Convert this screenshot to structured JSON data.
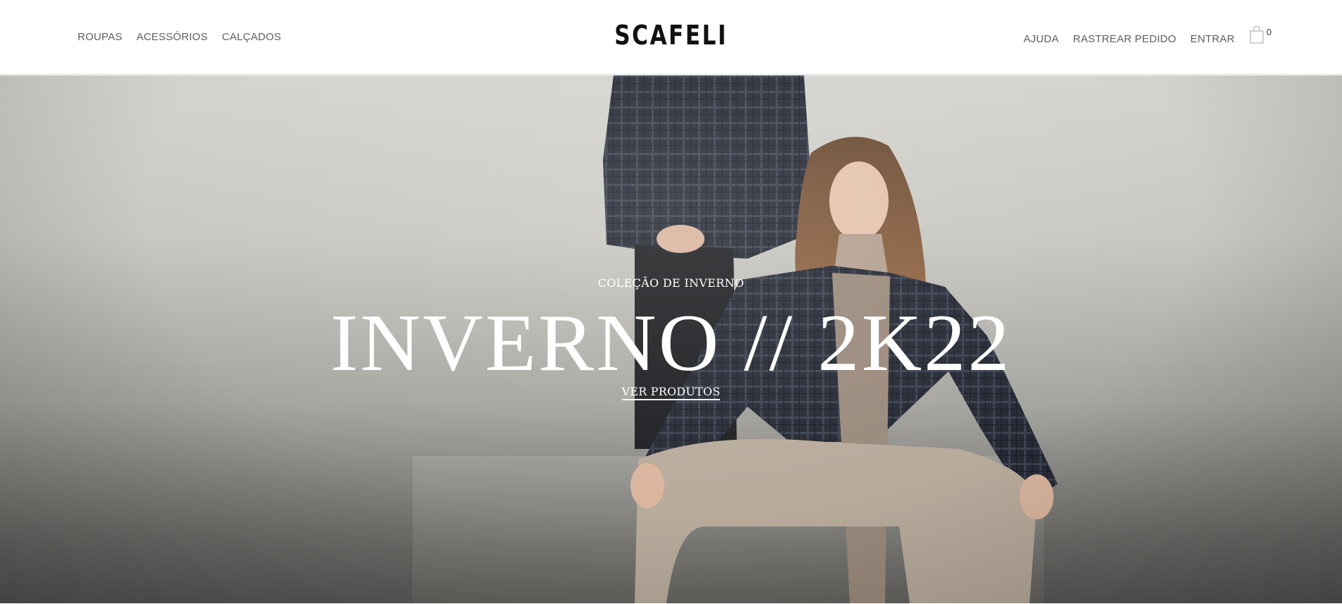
{
  "brand": {
    "name": "SCAFELI"
  },
  "nav_left": {
    "items": [
      {
        "label": "ROUPAS"
      },
      {
        "label": "ACESSÓRIOS"
      },
      {
        "label": "CALÇADOS"
      }
    ]
  },
  "nav_right": {
    "items": [
      {
        "label": "AJUDA"
      },
      {
        "label": "RASTREAR PEDIDO"
      },
      {
        "label": "ENTRAR"
      }
    ],
    "cart": {
      "icon": "shopping-bag-icon",
      "count": "0"
    }
  },
  "hero": {
    "eyebrow": "COLEÇÃO DE INVERNO",
    "headline": "INVERNO // 2K22",
    "cta": "VER PRODUTOS"
  },
  "colors": {
    "nav_text": "#5a5f66",
    "brand_text": "#111111",
    "hero_text": "#ffffff"
  }
}
